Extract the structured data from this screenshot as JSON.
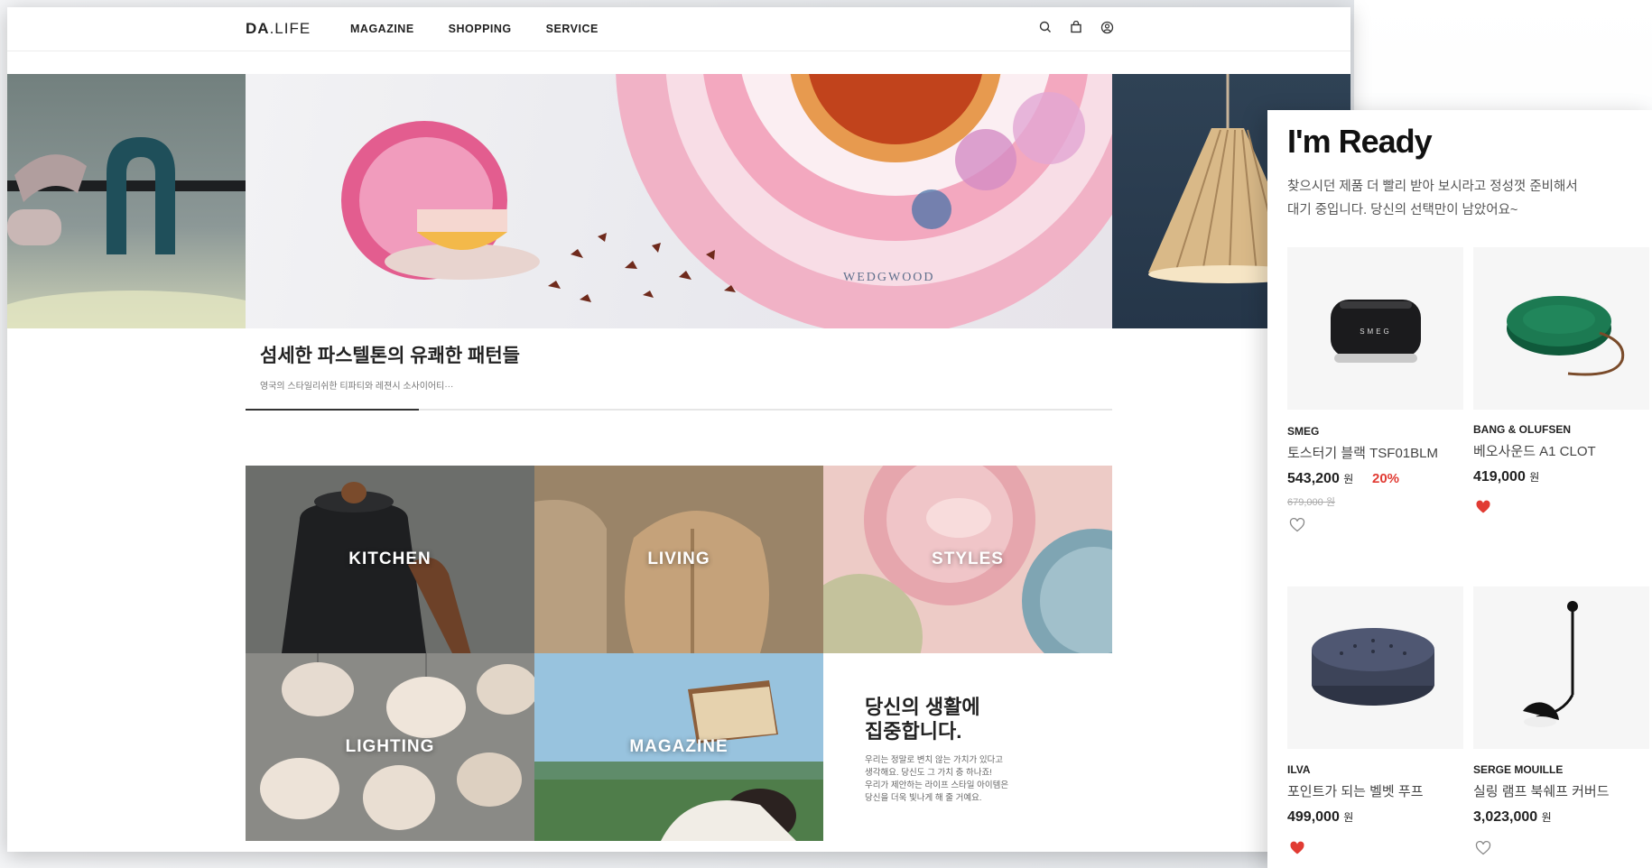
{
  "header": {
    "logo_bold": "DA",
    "logo_rest": ".LIFE",
    "nav": [
      "MAGAZINE",
      "SHOPPING",
      "SERVICE"
    ]
  },
  "hero": {
    "brand_watermark": "WEDGWOOD",
    "title": "섬세한 파스텔톤의 유쾌한 패턴들",
    "desc": "영국의 스타일리쉬한 티파티와 레젼시 소사이어티···",
    "slide_progress": 0.2
  },
  "categories": [
    {
      "label": "KITCHEN"
    },
    {
      "label": "LIVING"
    },
    {
      "label": "STYLES"
    },
    {
      "label": "LIGHTING"
    },
    {
      "label": "MAGAZINE"
    }
  ],
  "promo": {
    "title_line1": "당신의 생활에",
    "title_line2": "집중합니다.",
    "body_line1": "우리는 정말로 변치 않는 가치가 있다고",
    "body_line2": "생각해요. 당신도 그 가치 충 하나죠!",
    "body_line3": "우리가 제안하는 라이프 스타일 아이템은",
    "body_line4": "당신을 더욱 빛나게 해 줄 거예요."
  },
  "panel": {
    "title": "I'm Ready",
    "sub_line1": "찾으시던 제품 더 빨리 받아 보시라고 정성껏 준비해서",
    "sub_line2": "대기 중입니다. 당신의 선택만이 남았어요~",
    "products": [
      {
        "brand": "SMEG",
        "name": "토스터기 블랙 TSF01BLM",
        "price": "543,200",
        "won": "원",
        "discount": "20%",
        "original": "679,000 원",
        "liked": false
      },
      {
        "brand": "BANG & OLUFSEN",
        "name": "베오사운드 A1 CLOT",
        "price": "419,000",
        "won": "원",
        "liked": true
      },
      {
        "brand": "ILVA",
        "name": "포인트가 되는 벨벳 푸프",
        "price": "499,000",
        "won": "원",
        "liked": true
      },
      {
        "brand": "SERGE MOUILLE",
        "name": "실링 램프 북쉐프 커버드",
        "price": "3,023,000",
        "won": "원",
        "liked": false
      }
    ],
    "toaster_label": "SMEG"
  },
  "colors": {
    "accent_red": "#e13b33",
    "text_dark": "#222222"
  }
}
